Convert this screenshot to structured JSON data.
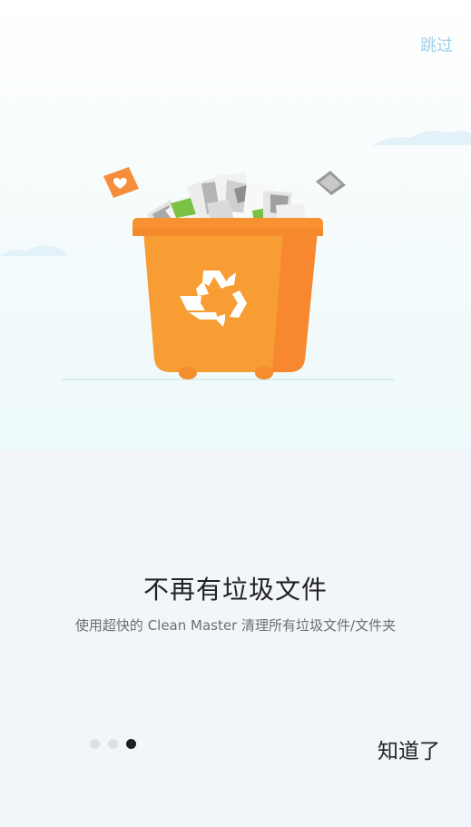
{
  "header": {
    "skip_label": "跳过"
  },
  "onboarding": {
    "title": "不再有垃圾文件",
    "subtitle": "使用超快的 Clean Master 清理所有垃圾文件/文件夹",
    "confirm_label": "知道了",
    "page_indicator": {
      "total": 3,
      "current": 3
    }
  },
  "icons": {
    "trash": "recycle-bin-icon",
    "recycle": "recycle-symbol-icon",
    "heart": "heart-icon"
  },
  "colors": {
    "accent_orange": "#f79b34",
    "skip_text": "#9fd1ea",
    "title_text": "#222222",
    "subtitle_text": "#6b6f75"
  }
}
